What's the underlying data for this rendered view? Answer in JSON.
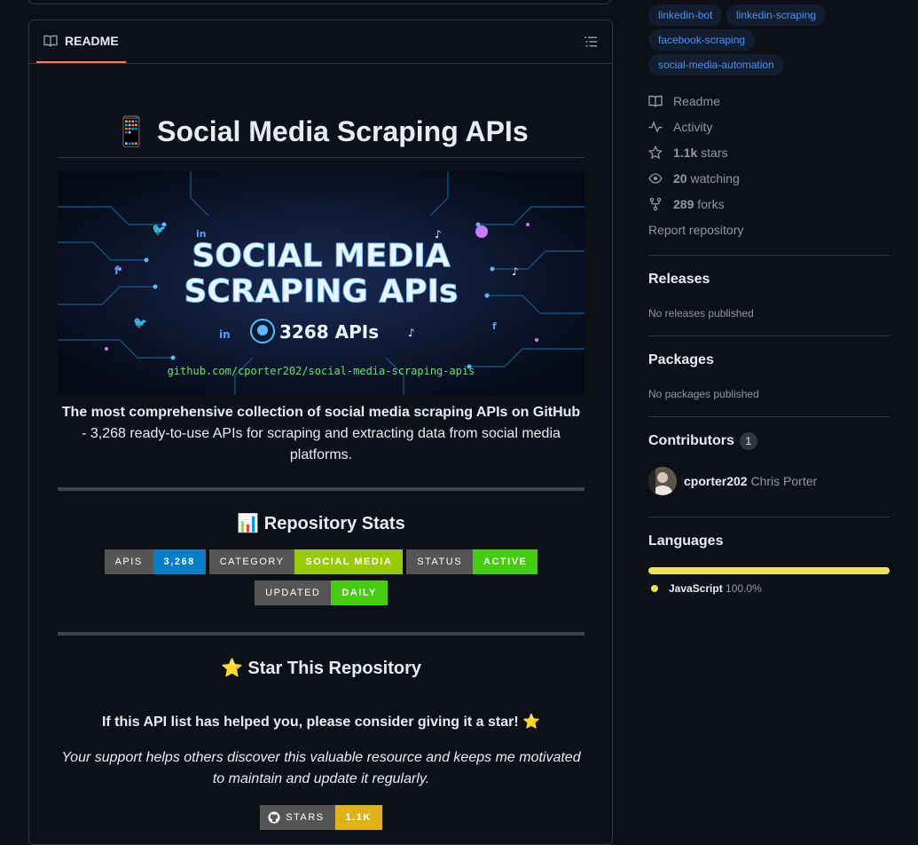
{
  "readme_tab": {
    "label": "README"
  },
  "readme": {
    "title": "Social Media Scraping APIs",
    "title_emoji": "📱",
    "banner": {
      "line1": "SOCIAL MEDIA",
      "line2": "SCRAPING APIs",
      "count": "3268 APIs",
      "url": "github.com/cporter202/social-media-scraping-apis"
    },
    "tagline_bold": "The most comprehensive collection of social media scraping APIs on GitHub",
    "tagline_rest": "- 3,268 ready-to-use APIs for scraping and extracting data from social media platforms.",
    "stats_heading_emoji": "📊",
    "stats_heading": "Repository Stats",
    "badges": [
      {
        "label": "APIS",
        "value": "3,268",
        "color": "#007ec6"
      },
      {
        "label": "CATEGORY",
        "value": "SOCIAL MEDIA",
        "color": "#97ca00"
      },
      {
        "label": "STATUS",
        "value": "ACTIVE",
        "color": "#4c1"
      },
      {
        "label": "UPDATED",
        "value": "DAILY",
        "color": "#4c1"
      }
    ],
    "star_heading_emoji": "⭐",
    "star_heading": "Star This Repository",
    "star_ask": "If this API list has helped you, please consider giving it a star! ⭐",
    "support_text": "Your support helps others discover this valuable resource and keeps me motivated to maintain and update it regularly.",
    "stars_badge": {
      "label": "STARS",
      "value": "1.1K",
      "color": "#dfb317"
    }
  },
  "sidebar": {
    "topics": [
      "linkedin-bot",
      "linkedin-scraping",
      "facebook-scraping",
      "social-media-automation"
    ],
    "links": {
      "readme": "Readme",
      "activity": "Activity",
      "stars_count": "1.1k",
      "stars_label": "stars",
      "watching_count": "20",
      "watching_label": "watching",
      "forks_count": "289",
      "forks_label": "forks",
      "report": "Report repository"
    },
    "releases": {
      "heading": "Releases",
      "empty": "No releases published"
    },
    "packages": {
      "heading": "Packages",
      "empty": "No packages published"
    },
    "contributors": {
      "heading": "Contributors",
      "count": "1",
      "login": "cporter202",
      "name": "Chris Porter"
    },
    "languages": {
      "heading": "Languages",
      "name": "JavaScript",
      "percent": "100.0%",
      "fraction": 1.0,
      "color": "#f1e05a"
    }
  }
}
